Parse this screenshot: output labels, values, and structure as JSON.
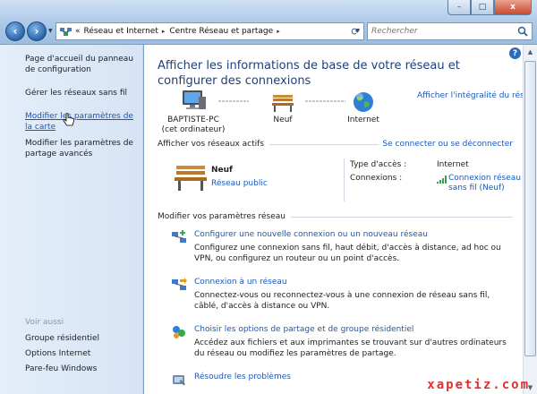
{
  "window": {
    "minimize": "–",
    "maximize": "□",
    "close": "x"
  },
  "nav": {
    "back": "‹",
    "forward": "›"
  },
  "address": {
    "chevrons": "«",
    "crumbs": [
      "Réseau et Internet",
      "Centre Réseau et partage"
    ],
    "separator": "▸"
  },
  "search": {
    "placeholder": "Rechercher"
  },
  "sidebar": {
    "links": [
      "Page d'accueil du panneau de configuration",
      "Gérer les réseaux sans fil",
      "Modifier les paramètres de la carte",
      "Modifier les paramètres de partage avancés"
    ],
    "see_also": "Voir aussi",
    "bottom_links": [
      "Groupe résidentiel",
      "Options Internet",
      "Pare-feu Windows"
    ]
  },
  "main": {
    "help": "?",
    "heading": "Afficher les informations de base de votre réseau et configurer des connexions",
    "map": {
      "nodes": [
        {
          "label_1": "BAPTISTE-PC",
          "label_2": "(cet ordinateur)"
        },
        {
          "label_1": "Neuf",
          "label_2": ""
        },
        {
          "label_1": "Internet",
          "label_2": ""
        }
      ],
      "full_map_link": "Afficher l'intégralité du réseau"
    },
    "active_section": {
      "title": "Afficher vos réseaux actifs",
      "link": "Se connecter ou se déconnecter",
      "network_name": "Neuf",
      "network_type": "Réseau public",
      "access_type_label": "Type d'accès :",
      "access_type_value": "Internet",
      "connections_label": "Connexions :",
      "connections_value": "Connexion réseau sans fil (Neuf)"
    },
    "settings_section": {
      "title": "Modifier vos paramètres réseau"
    },
    "tasks": [
      {
        "title": "Configurer une nouvelle connexion ou un nouveau réseau",
        "desc": "Configurez une connexion sans fil, haut débit, d'accès à distance, ad hoc ou VPN, ou configurez un routeur ou un point d'accès."
      },
      {
        "title": "Connexion à un réseau",
        "desc": "Connectez-vous ou reconnectez-vous à une connexion de réseau sans fil, câblé, d'accès à distance ou VPN."
      },
      {
        "title": "Choisir les options de partage et de groupe résidentiel",
        "desc": "Accédez aux fichiers et aux imprimantes se trouvant sur d'autres ordinateurs du réseau ou modifiez les paramètres de partage."
      },
      {
        "title": "Résoudre les problèmes",
        "desc": ""
      }
    ]
  },
  "watermark": "xapetiz.com",
  "colors": {
    "link": "#1b57b8",
    "heading": "#1f3f78",
    "sidebar_bg": "#dde8f7"
  }
}
